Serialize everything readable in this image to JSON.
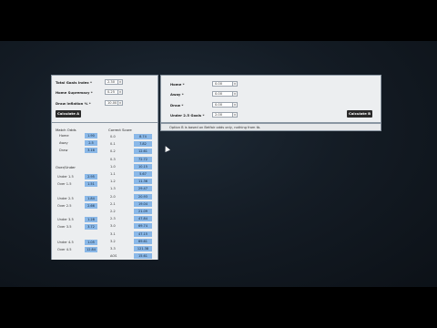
{
  "panel_a": {
    "total_goals_label": "Total Goals Index *",
    "total_goals_value": "2.30",
    "home_supremacy_label": "Home Supremacy *",
    "home_supremacy_value": "0.25",
    "draw_inflation_label": "Draw Inflation % *",
    "draw_inflation_value": "10.00",
    "calculate_label": "Calculate A"
  },
  "panel_b": {
    "home_label": "Home *",
    "home_value": "0.00",
    "away_label": "Away *",
    "away_value": "0.00",
    "draw_label": "Draw *",
    "draw_value": "0.00",
    "under_label": "Under 2.5 Goals *",
    "under_value": "2.00",
    "calculate_label": "Calculate B"
  },
  "note": "Option B is based on Betfair odds only, nothing from tb.",
  "match_odds": {
    "title": "Match Odds",
    "rows": [
      {
        "label": "Home",
        "value": "1.90"
      },
      {
        "label": "Away",
        "value": "2.5"
      },
      {
        "label": "Draw",
        "value": "3.16"
      }
    ]
  },
  "over_under": {
    "title": "Over/Under",
    "groups": [
      [
        {
          "label": "Under 1.5",
          "value": "2.95"
        },
        {
          "label": "Over 1.5",
          "value": "1.51"
        }
      ],
      [
        {
          "label": "Under 2.5",
          "value": "1.84"
        },
        {
          "label": "Over 2.5",
          "value": "2.66"
        }
      ],
      [
        {
          "label": "Under 3.5",
          "value": "1.28"
        },
        {
          "label": "Over 3.5",
          "value": "3.72"
        }
      ],
      [
        {
          "label": "Under 4.5",
          "value": "1.05"
        },
        {
          "label": "Over 4.5",
          "value": "12.84"
        }
      ]
    ]
  },
  "correct_score": {
    "title": "Correct Score",
    "rows": [
      {
        "score": "0-0",
        "value": "8.74"
      },
      {
        "score": "0-1",
        "value": "7.82"
      },
      {
        "score": "0-2",
        "value": "12.61"
      },
      {
        "score": "0-3",
        "value": "72.72"
      },
      {
        "score": "1-0",
        "value": "10.15"
      },
      {
        "score": "1-1",
        "value": "5.67"
      },
      {
        "score": "1-2",
        "value": "11.36"
      },
      {
        "score": "1-3",
        "value": "29.47"
      },
      {
        "score": "2-0",
        "value": "20.93"
      },
      {
        "score": "2-1",
        "value": "19.04"
      },
      {
        "score": "2-2",
        "value": "21.09"
      },
      {
        "score": "2-3",
        "value": "47.84"
      },
      {
        "score": "3-0",
        "value": "69.74"
      },
      {
        "score": "3-1",
        "value": "47.15"
      },
      {
        "score": "3-2",
        "value": "69.61"
      },
      {
        "score": "3-3",
        "value": "121.38"
      },
      {
        "score": "AOS",
        "value": "15.61"
      }
    ]
  }
}
